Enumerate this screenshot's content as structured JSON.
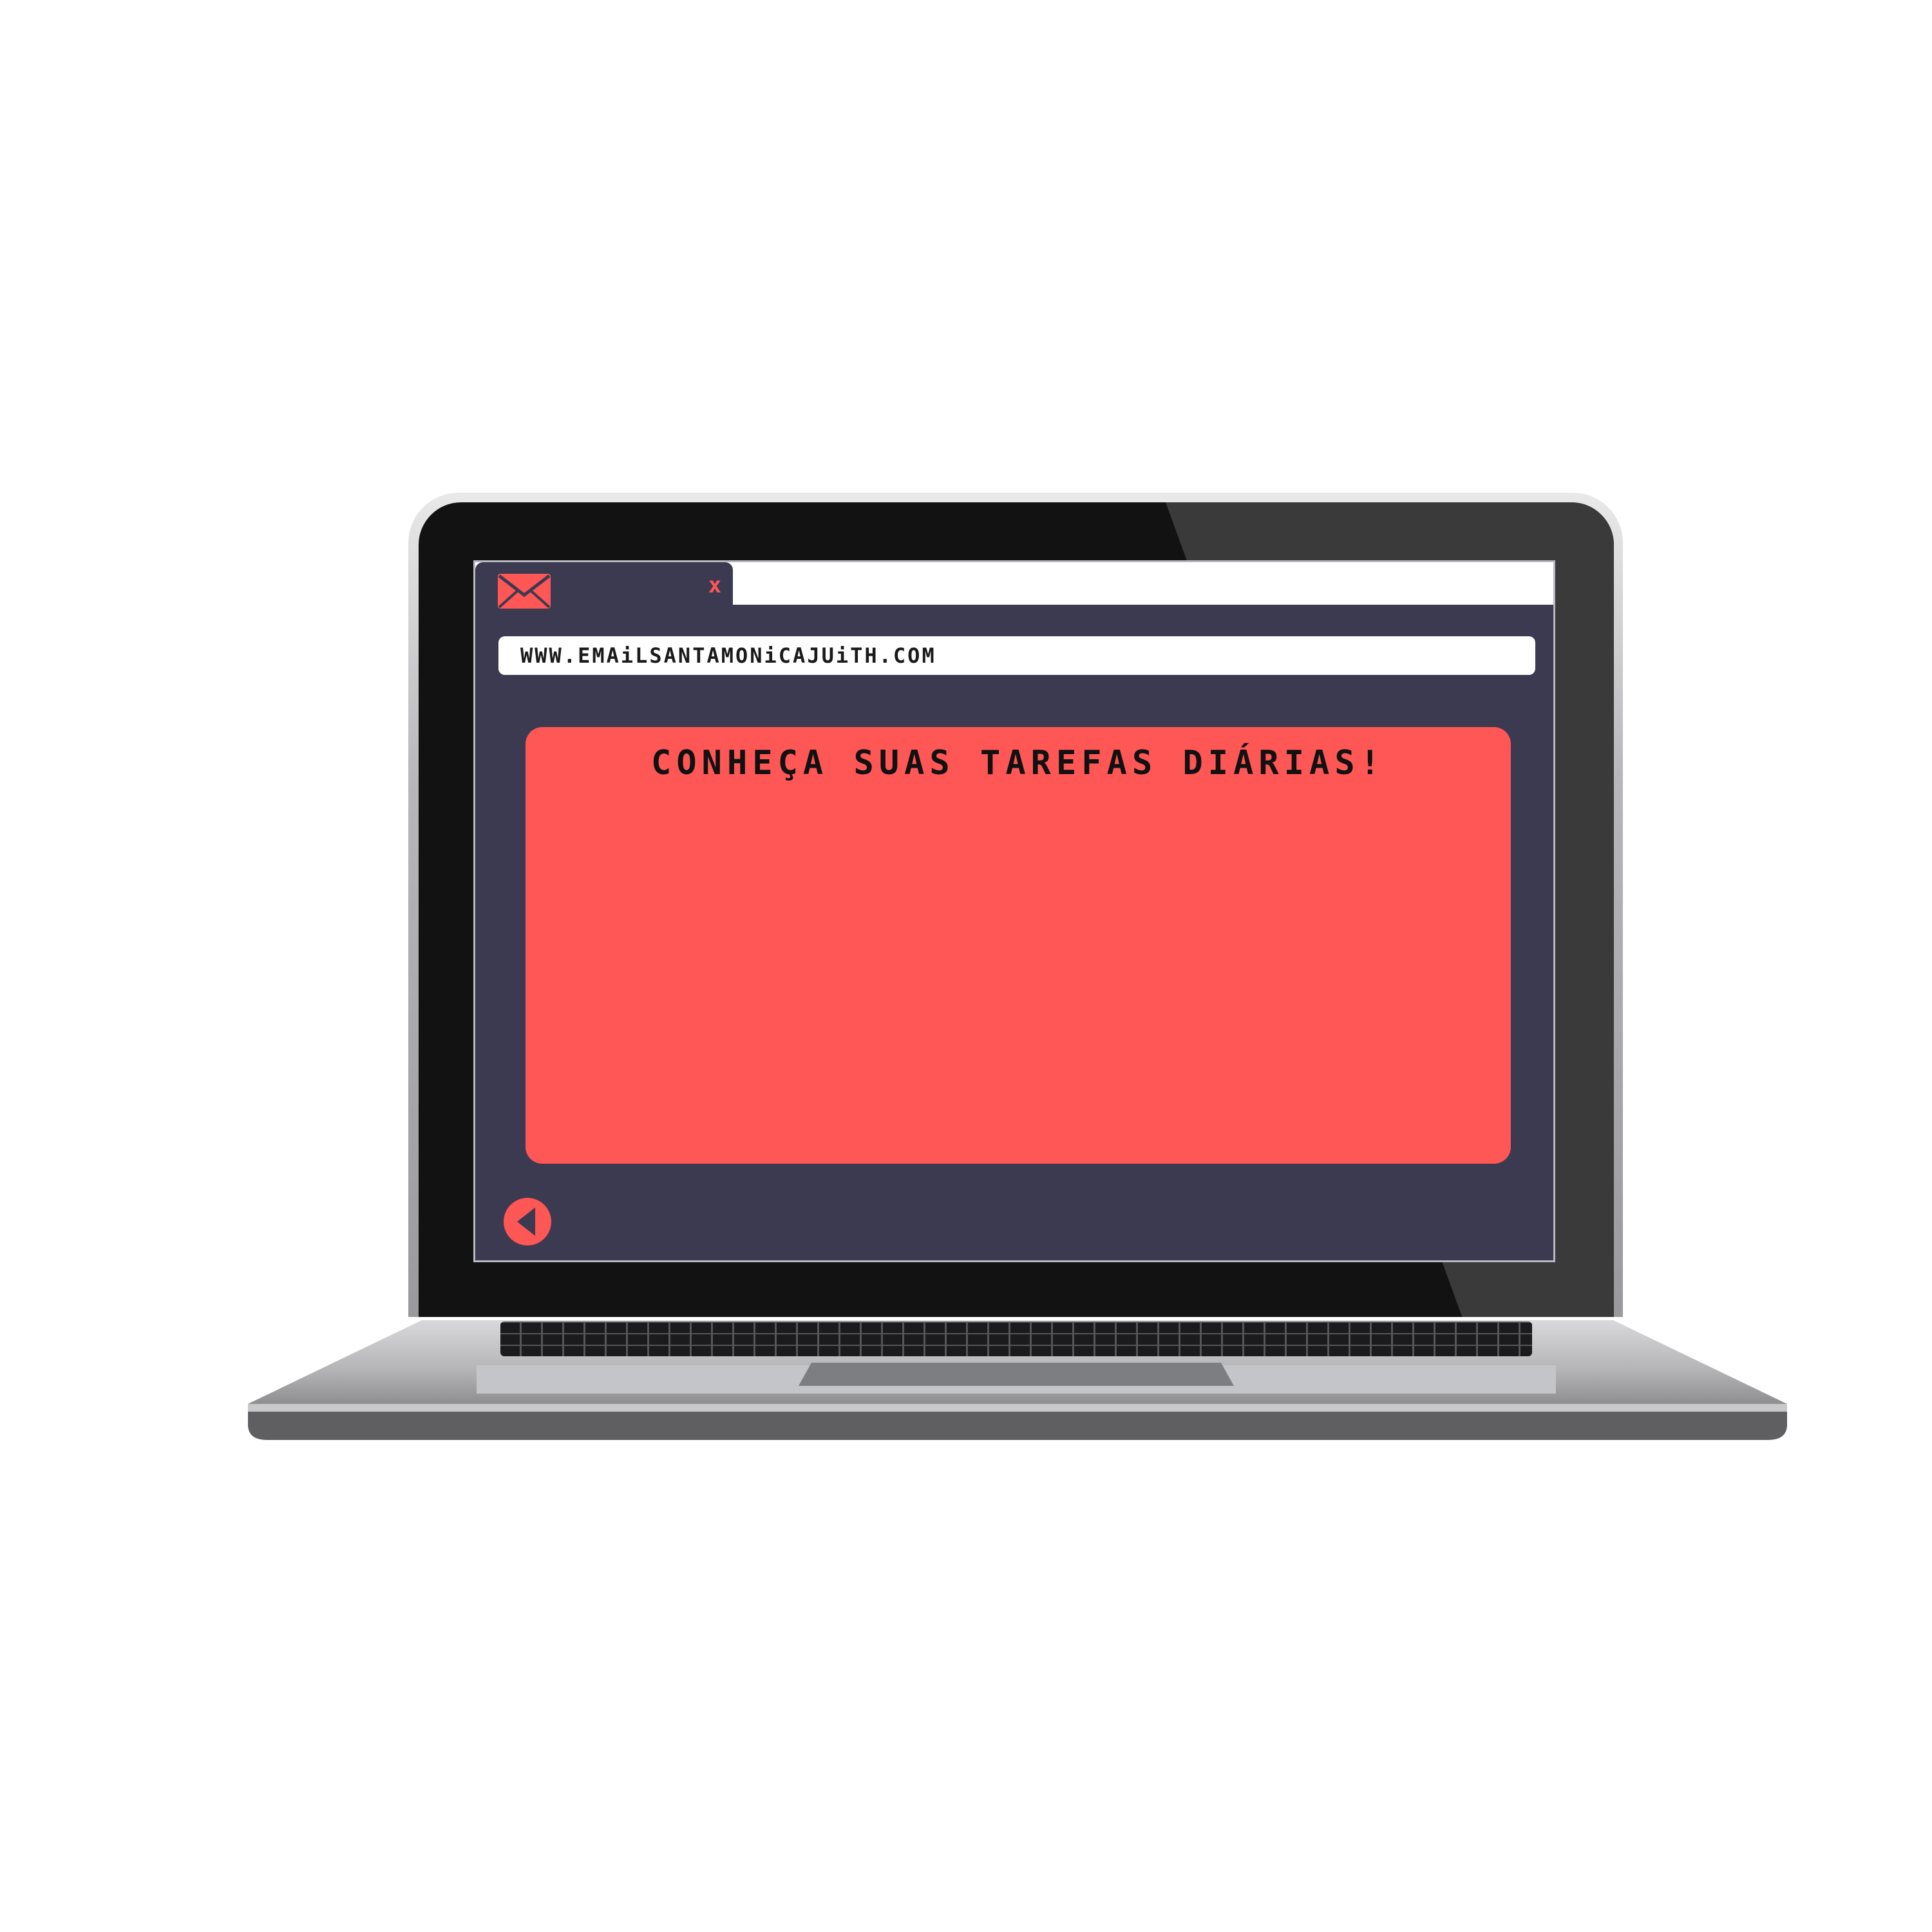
{
  "browser": {
    "tab": {
      "icon": "mail-icon",
      "close_label": "x"
    },
    "address_bar": {
      "url": "WWW.EMAiLSANTAMONiCAJUiTH.COM"
    },
    "content": {
      "title": "CONHEÇA SUAS TAREFAS DIÁRIAS!"
    },
    "nav": {
      "back_icon": "back-arrow-icon"
    }
  },
  "colors": {
    "accent": "#ff5656",
    "window_bg": "#3c3a50",
    "tab_strip": "#ffffff",
    "bezel": "#121212",
    "chassis": "#b7b7b9"
  }
}
